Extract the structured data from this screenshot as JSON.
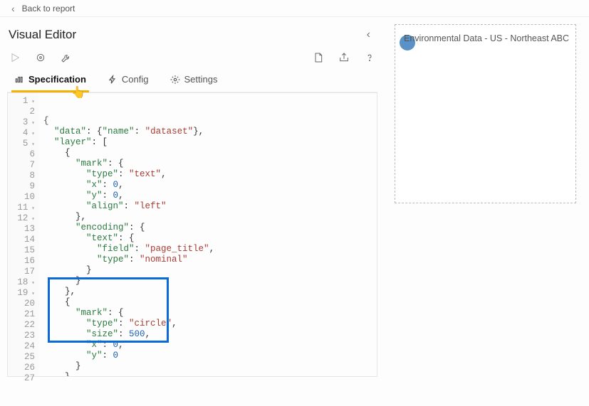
{
  "top": {
    "back_label": "Back to report"
  },
  "header": {
    "title": "Visual Editor"
  },
  "toolbar": {
    "play": "play-icon",
    "target": "target-icon",
    "wrench": "wrench-icon",
    "new": "new-doc-icon",
    "share": "share-icon",
    "help": "help-icon"
  },
  "tabs": [
    {
      "label": "Specification",
      "icon": "bars"
    },
    {
      "label": "Config",
      "icon": "bolt"
    },
    {
      "label": "Settings",
      "icon": "gear"
    }
  ],
  "active_tab": 0,
  "editor_lines": [
    {
      "n": 1,
      "fold": true,
      "html": "<span class='s-pun'>{</span>"
    },
    {
      "n": 2,
      "fold": false,
      "html": "  <span class='s-key'>\"data\"</span>: {<span class='s-key'>\"name\"</span>: <span class='s-str'>\"dataset\"</span>},"
    },
    {
      "n": 3,
      "fold": true,
      "html": "  <span class='s-key'>\"layer\"</span>: ["
    },
    {
      "n": 4,
      "fold": true,
      "html": "    {"
    },
    {
      "n": 5,
      "fold": true,
      "html": "      <span class='s-key'>\"mark\"</span>: {"
    },
    {
      "n": 6,
      "fold": false,
      "html": "        <span class='s-key'>\"type\"</span>: <span class='s-str'>\"text\"</span>,"
    },
    {
      "n": 7,
      "fold": false,
      "html": "        <span class='s-key'>\"x\"</span>: <span class='s-num'>0</span>,"
    },
    {
      "n": 8,
      "fold": false,
      "html": "        <span class='s-key'>\"y\"</span>: <span class='s-num'>0</span>,"
    },
    {
      "n": 9,
      "fold": false,
      "html": "        <span class='s-key'>\"align\"</span>: <span class='s-str'>\"left\"</span>"
    },
    {
      "n": 10,
      "fold": false,
      "html": "      },"
    },
    {
      "n": 11,
      "fold": true,
      "html": "      <span class='s-key'>\"encoding\"</span>: {"
    },
    {
      "n": 12,
      "fold": true,
      "html": "        <span class='s-key'>\"text\"</span>: {"
    },
    {
      "n": 13,
      "fold": false,
      "html": "          <span class='s-key'>\"field\"</span>: <span class='s-str'>\"page_title\"</span>,"
    },
    {
      "n": 14,
      "fold": false,
      "html": "          <span class='s-key'>\"type\"</span>: <span class='s-str'>\"nominal\"</span>"
    },
    {
      "n": 15,
      "fold": false,
      "html": "        }"
    },
    {
      "n": 16,
      "fold": false,
      "html": "      }"
    },
    {
      "n": 17,
      "fold": false,
      "html": "    },"
    },
    {
      "n": 18,
      "fold": true,
      "html": "    {"
    },
    {
      "n": 19,
      "fold": true,
      "html": "      <span class='s-key'>\"mark\"</span>: {"
    },
    {
      "n": 20,
      "fold": false,
      "html": "        <span class='s-key'>\"type\"</span>: <span class='s-str'>\"circle\"</span>,"
    },
    {
      "n": 21,
      "fold": false,
      "html": "        <span class='s-key'>\"size\"</span>: <span class='s-num'>500</span>,"
    },
    {
      "n": 22,
      "fold": false,
      "html": "        <span class='s-key'>\"x\"</span>: <span class='s-num'>0</span>,"
    },
    {
      "n": 23,
      "fold": false,
      "html": "        <span class='s-key'>\"y\"</span>: <span class='s-num'>0</span>"
    },
    {
      "n": 24,
      "fold": false,
      "html": "      }"
    },
    {
      "n": 25,
      "fold": false,
      "html": "    }"
    },
    {
      "n": 26,
      "fold": false,
      "html": "  ]"
    },
    {
      "n": 27,
      "fold": false,
      "html": "}<span class='s-pun'>|</span>"
    }
  ],
  "preview": {
    "text": "Environmental Data - US - Northeast ABC"
  }
}
